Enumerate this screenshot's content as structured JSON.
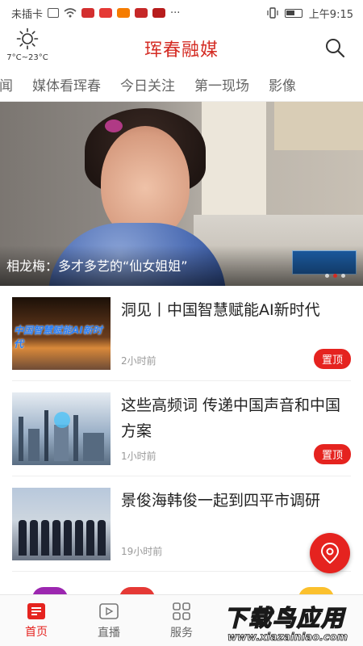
{
  "status_bar": {
    "carrier": "未插卡",
    "time": "上午9:15",
    "more": "···"
  },
  "header": {
    "title": "珲春融媒",
    "weather": "7°C~23°C",
    "weather_icon": "sun-icon",
    "search_icon": "search-icon"
  },
  "tabs": [
    {
      "label": "新闻"
    },
    {
      "label": "媒体看珲春"
    },
    {
      "label": "今日关注"
    },
    {
      "label": "第一现场"
    },
    {
      "label": "影像"
    }
  ],
  "hero": {
    "caption": "相龙梅：多才多艺的“仙女姐姐”"
  },
  "news": [
    {
      "headline": "洞见丨中国智慧赋能AI新时代",
      "time": "2小时前",
      "badge": "置顶",
      "thumb_text": "中国智慧赋能AI新时代"
    },
    {
      "headline": "这些高频词 传递中国声音和中国方案",
      "time": "1小时前",
      "badge": "置顶"
    },
    {
      "headline": "景俊海韩俊一起到四平市调研",
      "time": "19小时前"
    }
  ],
  "bottom_nav": [
    {
      "label": "首页",
      "icon": "home-news-icon",
      "active": true
    },
    {
      "label": "直播",
      "icon": "live-icon",
      "active": false
    },
    {
      "label": "服务",
      "icon": "grid-icon",
      "active": false
    }
  ],
  "colors": {
    "brand": "#d42b23",
    "badge": "#e5231f"
  }
}
